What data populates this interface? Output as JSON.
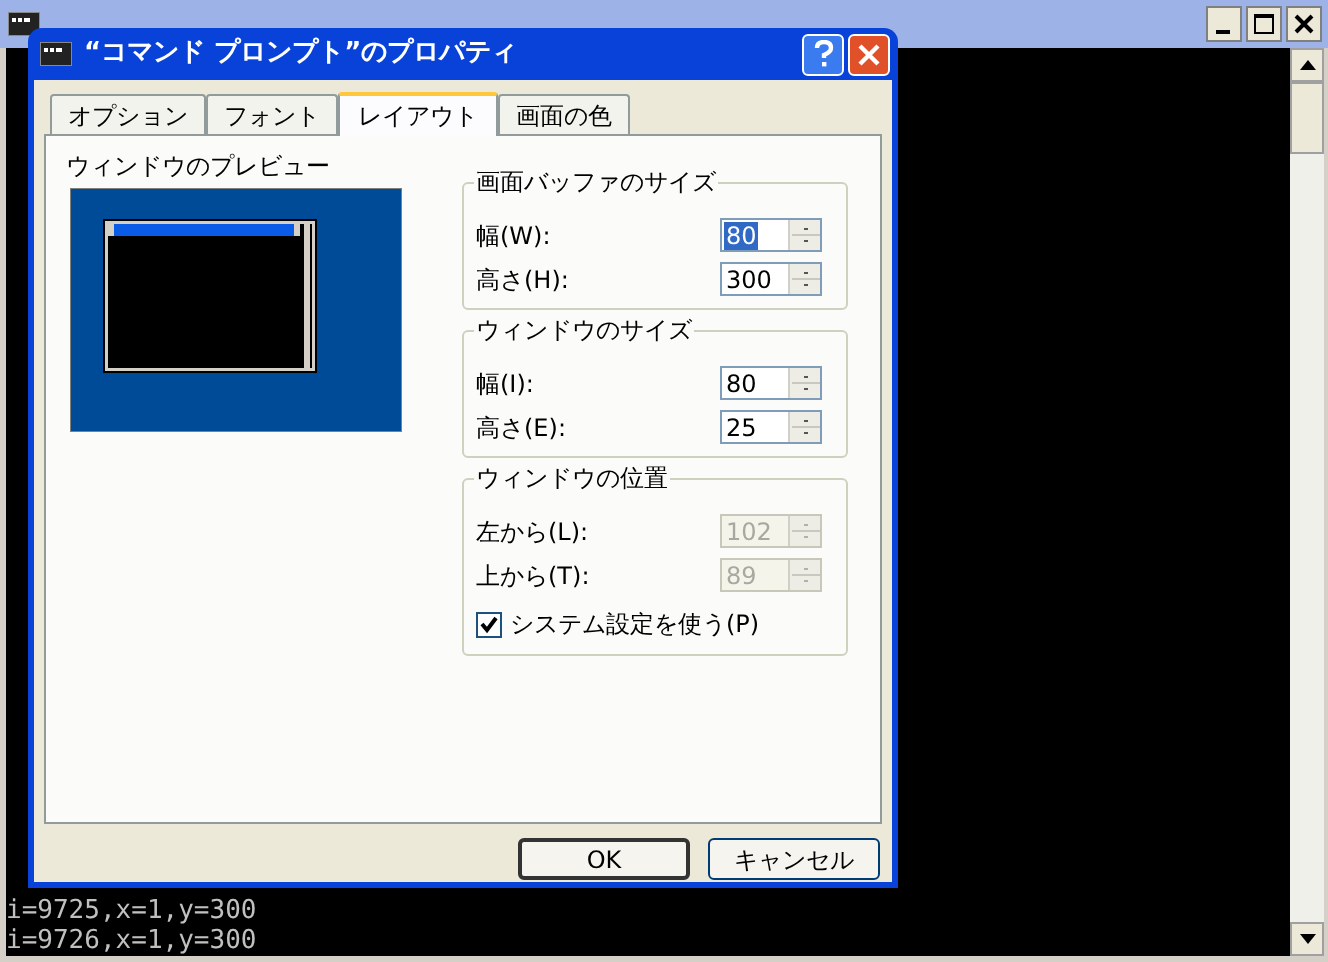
{
  "console_window": {
    "lines": [
      "i=9725,x=1,y=300",
      "i=9726,x=1,y=300"
    ]
  },
  "dialog": {
    "title": "“コマンド プロンプト”のプロパティ",
    "tabs": [
      {
        "label": "オプション",
        "selected": false
      },
      {
        "label": "フォント",
        "selected": false
      },
      {
        "label": "レイアウト",
        "selected": true
      },
      {
        "label": "画面の色",
        "selected": false
      }
    ],
    "preview": {
      "label": "ウィンドウのプレビュー"
    },
    "groups": [
      {
        "title": "画面バッファのサイズ",
        "fields": [
          {
            "label": "幅(W):",
            "value": "80",
            "disabled": false,
            "text_selected": true
          },
          {
            "label": "高さ(H):",
            "value": "300",
            "disabled": false,
            "text_selected": false
          }
        ]
      },
      {
        "title": "ウィンドウのサイズ",
        "fields": [
          {
            "label": "幅(I):",
            "value": "80",
            "disabled": false,
            "text_selected": false
          },
          {
            "label": "高さ(E):",
            "value": "25",
            "disabled": false,
            "text_selected": false
          }
        ]
      },
      {
        "title": "ウィンドウの位置",
        "fields": [
          {
            "label": "左から(L):",
            "value": "102",
            "disabled": true,
            "text_selected": false
          },
          {
            "label": "上から(T):",
            "value": "89",
            "disabled": true,
            "text_selected": false
          }
        ],
        "checkbox": {
          "label": "システム設定を使う(P)",
          "checked": true
        }
      }
    ],
    "buttons": [
      {
        "label": "OK",
        "default": true
      },
      {
        "label": "キャンセル",
        "default": false
      }
    ]
  }
}
